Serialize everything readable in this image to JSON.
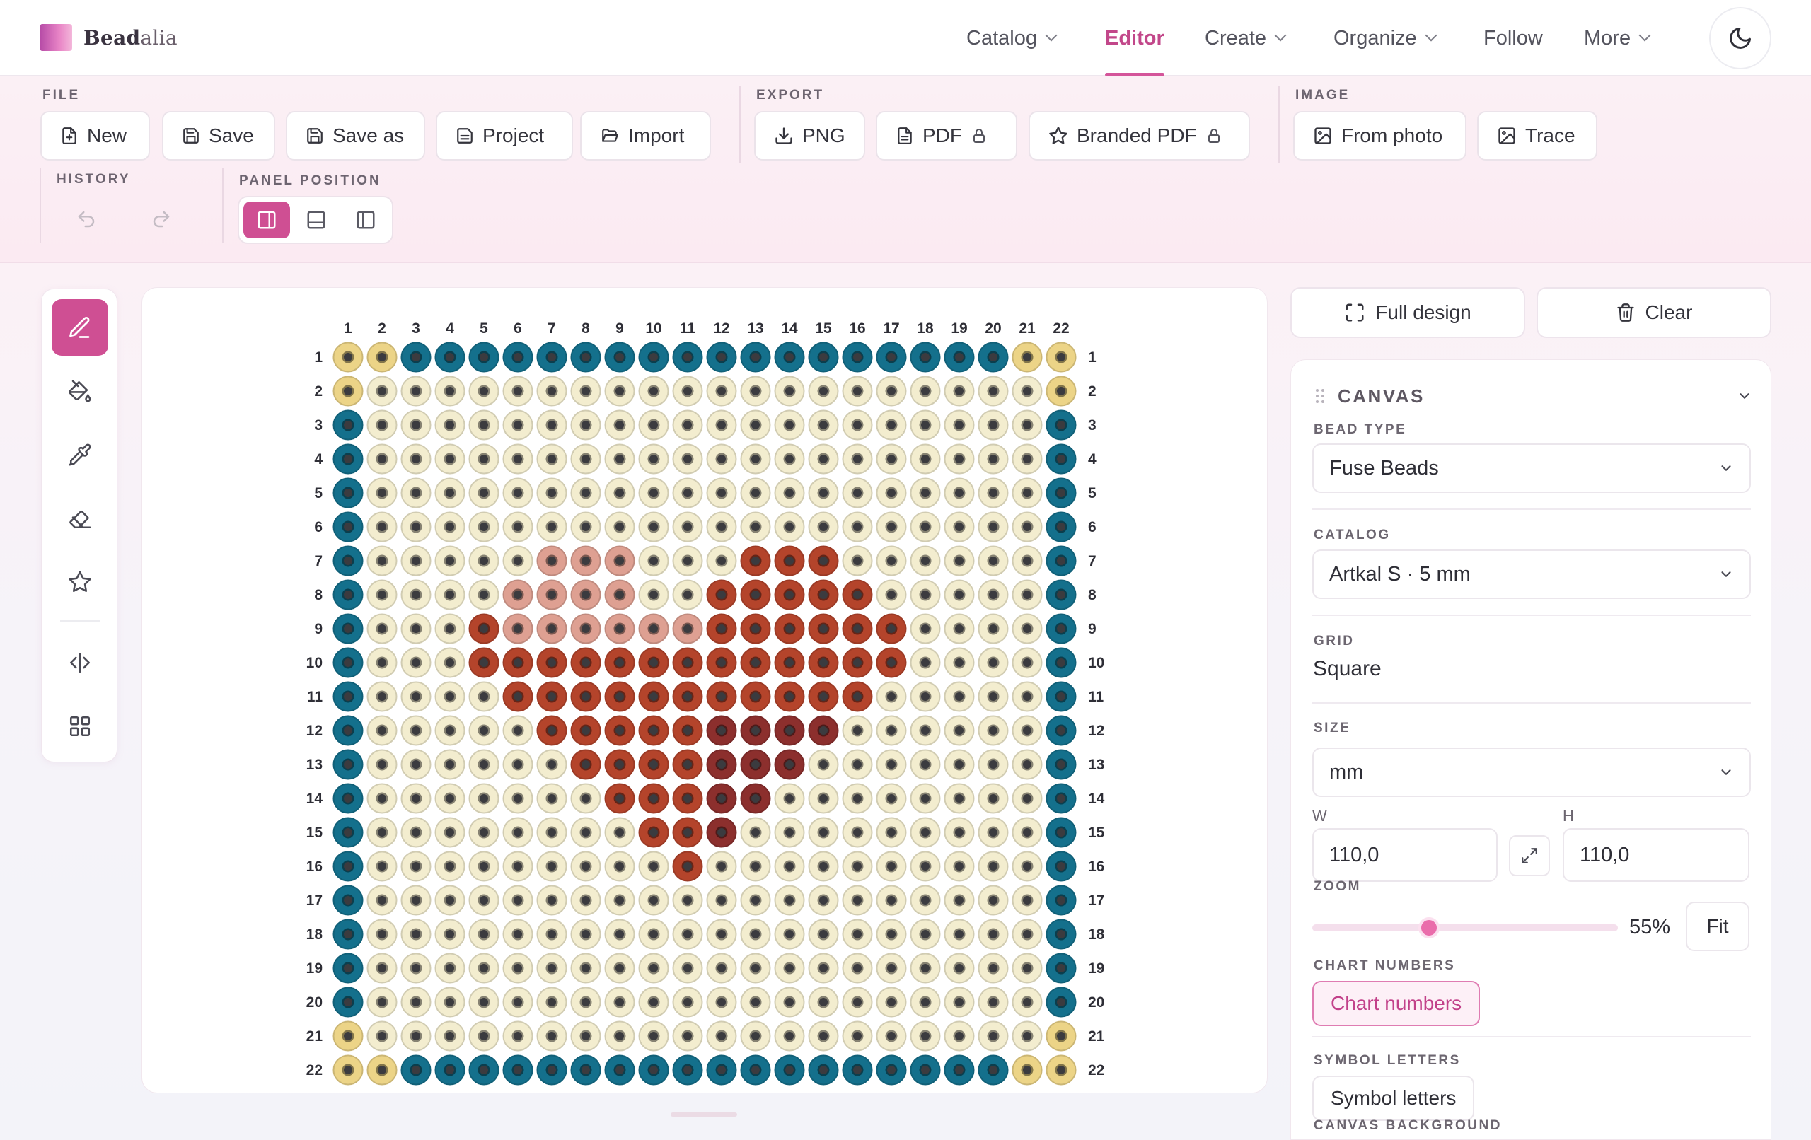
{
  "app": {
    "logo_bold": "Bead",
    "logo_rest": "alia"
  },
  "nav": [
    {
      "label": "Catalog",
      "dropdown": true,
      "active": false
    },
    {
      "label": "Editor",
      "dropdown": false,
      "active": true
    },
    {
      "label": "Create",
      "dropdown": true,
      "active": false
    },
    {
      "label": "Organize",
      "dropdown": true,
      "active": false
    },
    {
      "label": "Follow",
      "dropdown": false,
      "active": false
    },
    {
      "label": "More",
      "dropdown": true,
      "active": false
    }
  ],
  "toolbar": {
    "file_label": "FILE",
    "export_label": "EXPORT",
    "image_label": "IMAGE",
    "history_label": "HISTORY",
    "panel_position_label": "PANEL POSITION",
    "new": "New",
    "save": "Save",
    "save_as": "Save as",
    "project": "Project",
    "import": "Import",
    "png": "PNG",
    "pdf": "PDF",
    "branded_pdf": "Branded PDF",
    "from_photo": "From photo",
    "trace": "Trace"
  },
  "canvas_actions": {
    "full_design": "Full design",
    "clear": "Clear"
  },
  "panel": {
    "section_title": "CANVAS",
    "bead_type_label": "BEAD TYPE",
    "bead_type_value": "Fuse Beads",
    "catalog_label": "CATALOG",
    "catalog_value": "Artkal S · 5 mm",
    "grid_label": "GRID",
    "grid_value": "Square",
    "size_label": "SIZE",
    "size_unit": "mm",
    "w_label": "W",
    "w_value": "110,0",
    "h_label": "H",
    "h_value": "110,0",
    "zoom_label": "ZOOM",
    "zoom_value": "55%",
    "zoom_level": 0.55,
    "fit": "Fit",
    "chart_numbers_label": "CHART NUMBERS",
    "chart_numbers_btn": "Chart numbers",
    "symbol_letters_label": "SYMBOL LETTERS",
    "symbol_letters_btn": "Symbol letters",
    "canvas_bg_label": "CANVAS BACKGROUND"
  },
  "bead_grid": {
    "cols": 22,
    "rows": 22,
    "col_labels": [
      "1",
      "2",
      "3",
      "4",
      "5",
      "6",
      "7",
      "8",
      "9",
      "10",
      "11",
      "12",
      "13",
      "14",
      "15",
      "16",
      "17",
      "18",
      "19",
      "20",
      "21",
      "22"
    ],
    "row_labels": [
      "1",
      "2",
      "3",
      "4",
      "5",
      "6",
      "7",
      "8",
      "9",
      "10",
      "11",
      "12",
      "13",
      "14",
      "15",
      "16",
      "17",
      "18",
      "19",
      "20",
      "21",
      "22"
    ],
    "palette": {
      "C": "#f3edcf",
      "Y": "#ecd487",
      "B": "#14708c",
      "P": "#dea092",
      "R": "#b4442b",
      "D": "#8c2f2d"
    },
    "pattern": [
      "YYBBBBBBBBBBBBBBBBBBYY",
      "YCCCCCCCCCCCCCCCCCCCCY",
      "BCCCCCCCCCCCCCCCCCCCCB",
      "BCCCCCCCCCCCCCCCCCCCCB",
      "BCCCCCCCCCCCCCCCCCCCCB",
      "BCCCCCCCCCCCCCCCCCCCCB",
      "BCCCCCPPPCCCRRRCCCCCCB",
      "BCCCCPPPPCCRRRRRCCCCCB",
      "BCCCRPPPPPPRRRRRRCCCCB",
      "BCCCRRRRRRRRRRRRRCCCCB",
      "BCCCCRRRRRRRRRRRCCCCCB",
      "BCCCCCRRRRRDDDDCCCCCCB",
      "BCCCCCCRRRRDDDCCCCCCCB",
      "BCCCCCCCRRRDDCCCCCCCCB",
      "BCCCCCCCCRRDCCCCCCCCCB",
      "BCCCCCCCCCRCCCCCCCCCCB",
      "BCCCCCCCCCCCCCCCCCCCCB",
      "BCCCCCCCCCCCCCCCCCCCCB",
      "BCCCCCCCCCCCCCCCCCCCCB",
      "BCCCCCCCCCCCCCCCCCCCCB",
      "YCCCCCCCCCCCCCCCCCCCCY",
      "YYBBBBBBBBBBBBBBBBBBYY"
    ]
  },
  "colors": {
    "accent": "#cf4f93"
  }
}
